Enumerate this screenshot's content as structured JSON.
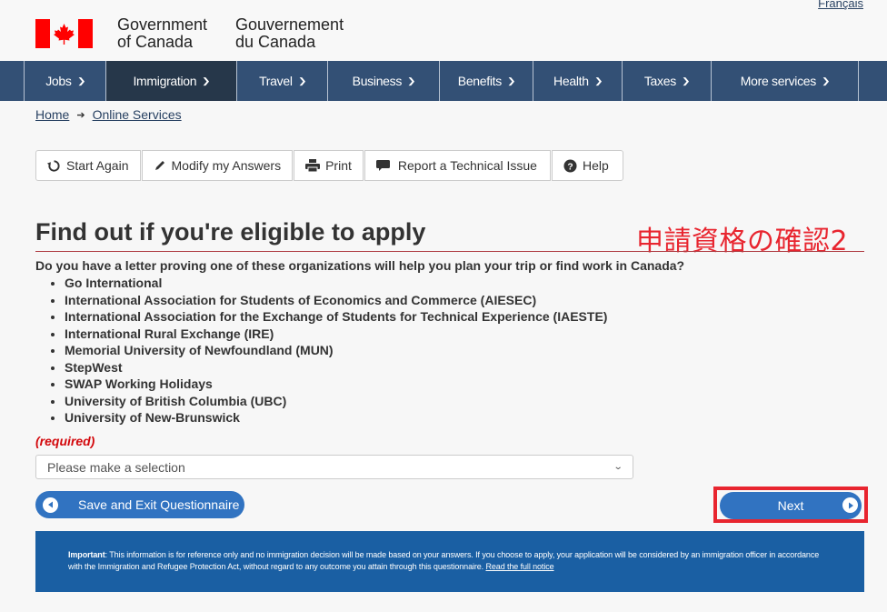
{
  "header": {
    "language_link": "Français",
    "signature_en_line1": "Government",
    "signature_en_line2": "of Canada",
    "signature_fr_line1": "Gouvernement",
    "signature_fr_line2": "du Canada",
    "flag_color": "#ff0000"
  },
  "nav": {
    "items": [
      {
        "label": "Jobs"
      },
      {
        "label": "Immigration",
        "active": true
      },
      {
        "label": "Travel"
      },
      {
        "label": "Business"
      },
      {
        "label": "Benefits"
      },
      {
        "label": "Health"
      },
      {
        "label": "Taxes"
      },
      {
        "label": "More services"
      }
    ]
  },
  "breadcrumb": [
    {
      "label": "Home"
    },
    {
      "label": "Online Services"
    }
  ],
  "toolbar": {
    "start_again": "Start Again",
    "modify_answers": "Modify my Answers",
    "print": "Print",
    "report_issue": "Report a Technical Issue",
    "help": "Help"
  },
  "main": {
    "title": "Find out if you're eligible to apply",
    "annotation": "申請資格の確認2",
    "question": "Do you have a letter proving one of these organizations will help you plan your trip or find work in Canada?",
    "organizations": [
      "Go International",
      "International Association for Students of Economics and Commerce (AIESEC)",
      "International Association for the Exchange of Students for Technical Experience (IAESTE)",
      "International Rural Exchange (IRE)",
      "Memorial University of Newfoundland (MUN)",
      "StepWest",
      "SWAP Working Holidays",
      "University of British Columbia (UBC)",
      "University of New-Brunswick"
    ],
    "required_label": "(required)",
    "select_value": "Please make a selection",
    "save_exit_label": "Save and Exit Questionnaire",
    "next_label": "Next"
  },
  "notice": {
    "bold": "Important",
    "text": ": This information is for reference only and no immigration decision will be made based on your answers. If you choose to apply, your application will be considered by an immigration officer in accordance with the Immigration and Refugee Protection Act, without regard to any outcome you attain through this questionnaire. ",
    "link": "Read the full notice"
  },
  "colors": {
    "nav_bg": "#335075",
    "nav_active": "#26374a",
    "button_blue": "#3173c1",
    "notice_bg": "#1a5fa3",
    "annotation_red": "#e8252f",
    "required_red": "#d3080c"
  }
}
